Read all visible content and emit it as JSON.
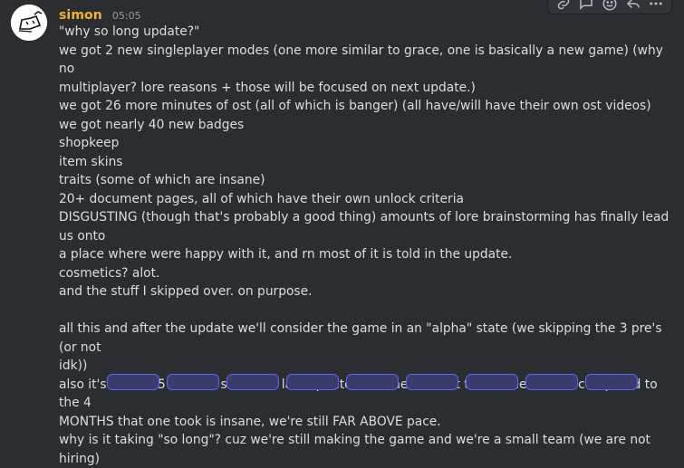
{
  "message": {
    "username": "simon",
    "timestamp": "05:05",
    "lines": [
      "\"why so long update?\"",
      "we got 2 new singleplayer modes (one more similar to grace, one is basically a new game) (why no",
      "multiplayer? lore reasons + those will be focused on next update.)",
      "we got 26 more minutes of ost (all of which is banger) (all have/will have their own ost videos)",
      "we got nearly 40 new badges",
      "shopkeep",
      "item skins",
      "traits (some of which are insane)",
      "20+ document pages, all of which have their own unlock criteria",
      "DISGUSTING (though that's probably a good thing) amounts of lore brainstorming has finally lead us onto",
      "a place where were happy with it, and rn most of it is told in the update.",
      "cosmetics? alot.",
      "and the stuff I skipped over. on purpose.",
      "",
      "all this and after the update we'll consider the game in an \"alpha\" state (we skipping the 3 pre's (or not",
      "idk))",
      "also it's been 2.5 months since the last update, and the amount that's been made compared to the 4",
      "MONTHS that one took is insane, we're still FAR ABOVE pace.",
      "why is it taking \"so long\"? cuz we're still making the game and we're a small team (we are not hiring)"
    ]
  },
  "toolbar": {
    "icons": [
      "link-icon",
      "thread-icon",
      "add-reaction-icon",
      "reply-icon",
      "more-icon"
    ]
  },
  "colors": {
    "background": "#2b2d31",
    "username": "#f0b232",
    "text": "#dbdee1",
    "timestamp": "#949ba4"
  }
}
